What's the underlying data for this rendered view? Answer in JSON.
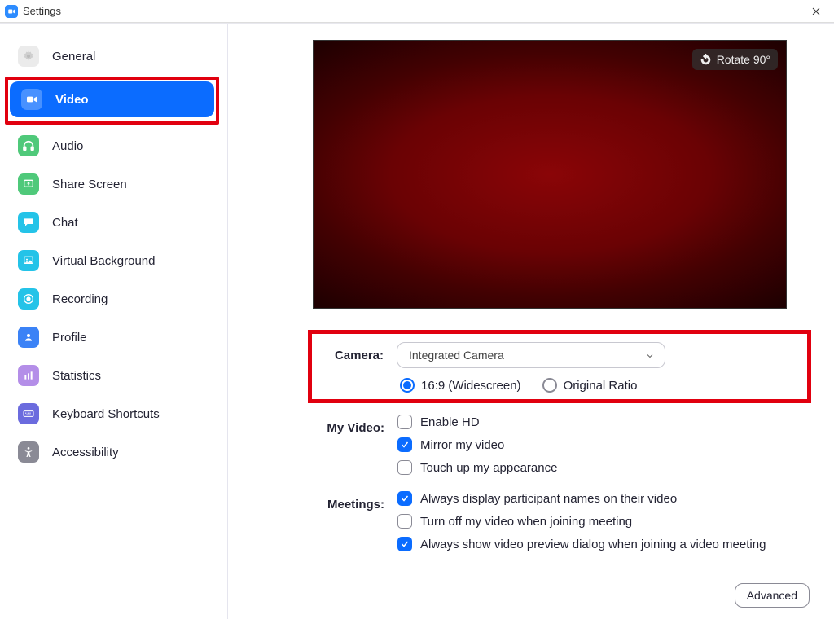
{
  "window": {
    "title": "Settings"
  },
  "sidebar": {
    "items": [
      {
        "label": "General"
      },
      {
        "label": "Video"
      },
      {
        "label": "Audio"
      },
      {
        "label": "Share Screen"
      },
      {
        "label": "Chat"
      },
      {
        "label": "Virtual Background"
      },
      {
        "label": "Recording"
      },
      {
        "label": "Profile"
      },
      {
        "label": "Statistics"
      },
      {
        "label": "Keyboard Shortcuts"
      },
      {
        "label": "Accessibility"
      }
    ]
  },
  "preview": {
    "rotate_label": "Rotate 90°"
  },
  "camera": {
    "label": "Camera:",
    "selected": "Integrated Camera",
    "ratio_widescreen": "16:9 (Widescreen)",
    "ratio_original": "Original Ratio"
  },
  "myvideo": {
    "label": "My Video:",
    "enable_hd": "Enable HD",
    "mirror": "Mirror my video",
    "touchup": "Touch up my appearance"
  },
  "meetings": {
    "label": "Meetings:",
    "display_names": "Always display participant names on their video",
    "turn_off": "Turn off my video when joining meeting",
    "show_preview": "Always show video preview dialog when joining a video meeting"
  },
  "buttons": {
    "advanced": "Advanced"
  }
}
